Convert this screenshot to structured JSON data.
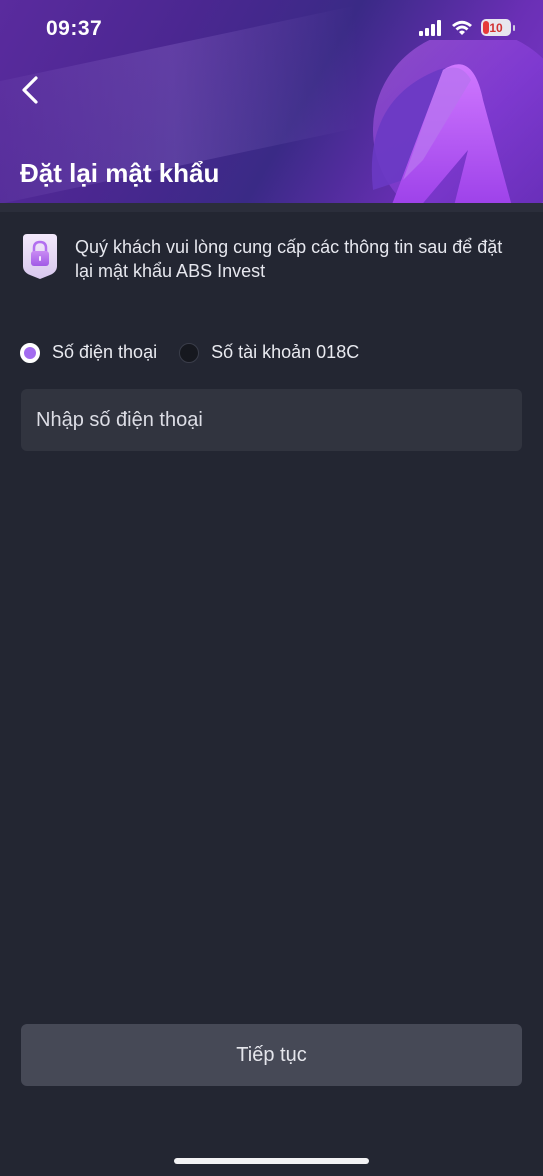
{
  "status_bar": {
    "time": "09:37",
    "battery_level": "10"
  },
  "header": {
    "title": "Đặt lại mật khẩu"
  },
  "info": {
    "message": "Quý khách vui lòng cung cấp các thông tin sau để đặt lại mật khẩu ABS Invest"
  },
  "radio_options": [
    {
      "label": "Số điện thoại",
      "selected": true
    },
    {
      "label": "Số tài khoản 018C",
      "selected": false
    }
  ],
  "phone_input": {
    "placeholder": "Nhập số điện thoại",
    "value": ""
  },
  "continue_button": {
    "label": "Tiếp tục"
  },
  "colors": {
    "background": "#232632",
    "accent": "#a36cf0",
    "input_bg": "#31343f",
    "button_bg": "#464956"
  }
}
